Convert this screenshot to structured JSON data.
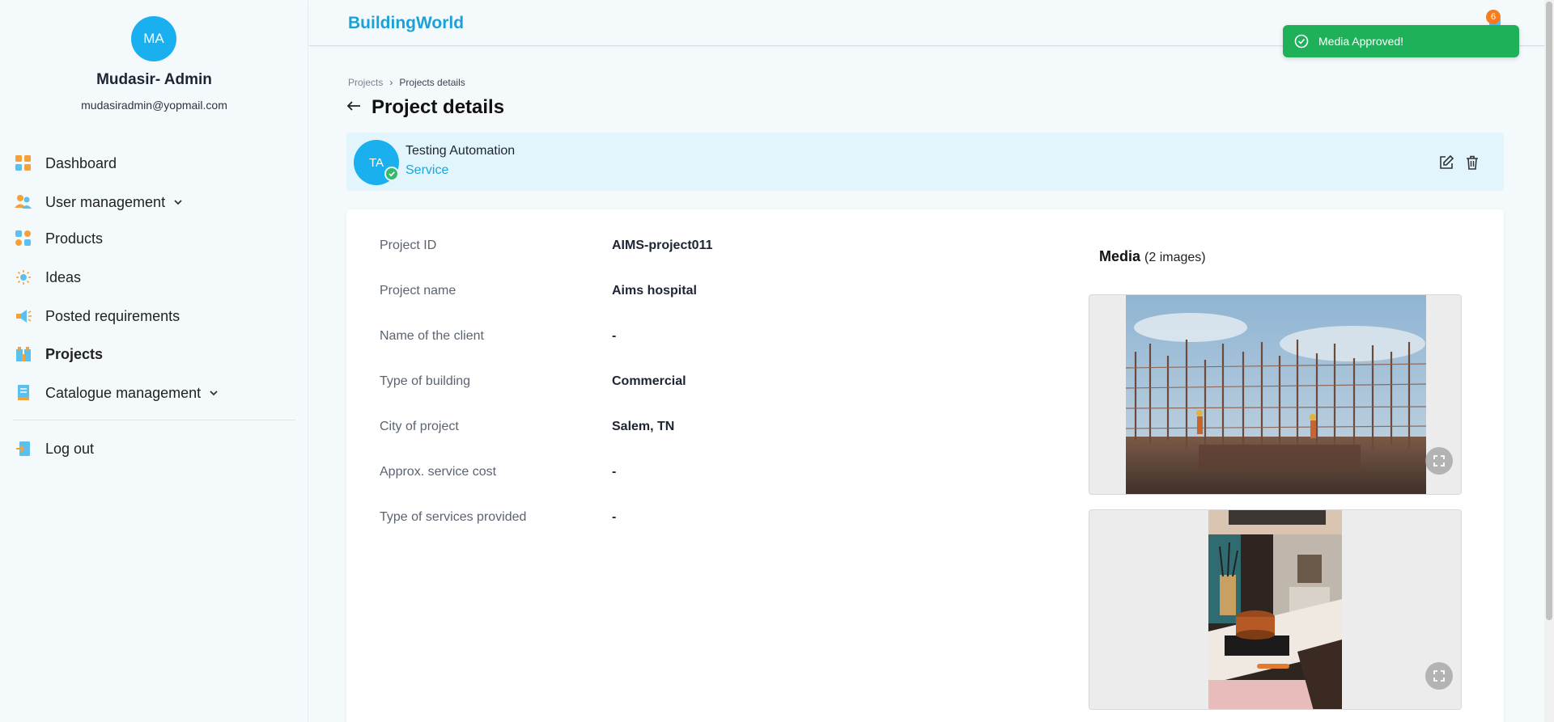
{
  "sidebar": {
    "avatar_initials": "MA",
    "user_name": "Mudasir- Admin",
    "user_email": "mudasiradmin@yopmail.com",
    "items": [
      {
        "label": "Dashboard",
        "icon": "dashboard-icon"
      },
      {
        "label": "User management",
        "icon": "users-icon",
        "expandable": true
      },
      {
        "label": "Products",
        "icon": "products-icon"
      },
      {
        "label": "Ideas",
        "icon": "lightbulb-icon"
      },
      {
        "label": "Posted requirements",
        "icon": "megaphone-icon"
      },
      {
        "label": "Projects",
        "icon": "projects-icon",
        "active": true
      },
      {
        "label": "Catalogue management",
        "icon": "catalogue-icon",
        "expandable": true
      }
    ],
    "logout_label": "Log out"
  },
  "header": {
    "brand": "BuildingWorld",
    "notification_count": "6"
  },
  "toast": {
    "message": "Media Approved!",
    "color": "#1fb05a"
  },
  "breadcrumb": {
    "parent": "Projects",
    "current": "Projects details"
  },
  "page_title": "Project details",
  "project": {
    "initials": "TA",
    "name": "Testing Automation",
    "type": "Service"
  },
  "details": [
    {
      "label": "Project ID",
      "value": "AIMS-project011"
    },
    {
      "label": "Project name",
      "value": "Aims hospital"
    },
    {
      "label": "Name of the client",
      "value": "-"
    },
    {
      "label": "Type of building",
      "value": "Commercial"
    },
    {
      "label": "City of project",
      "value": "Salem, TN"
    },
    {
      "label": "Approx. service cost",
      "value": "-"
    },
    {
      "label": "Type of services provided",
      "value": "-"
    }
  ],
  "media": {
    "title": "Media",
    "count_label": "(2 images)",
    "images": [
      {
        "subject": "construction-site-scaffolding-photo"
      },
      {
        "subject": "kitchen-stove-pot-photo"
      }
    ]
  },
  "colors": {
    "accent": "#1ab0f0",
    "brand": "#1ba1d8",
    "project_card_bg": "#e2f5fc",
    "badge": "#f57c20"
  }
}
